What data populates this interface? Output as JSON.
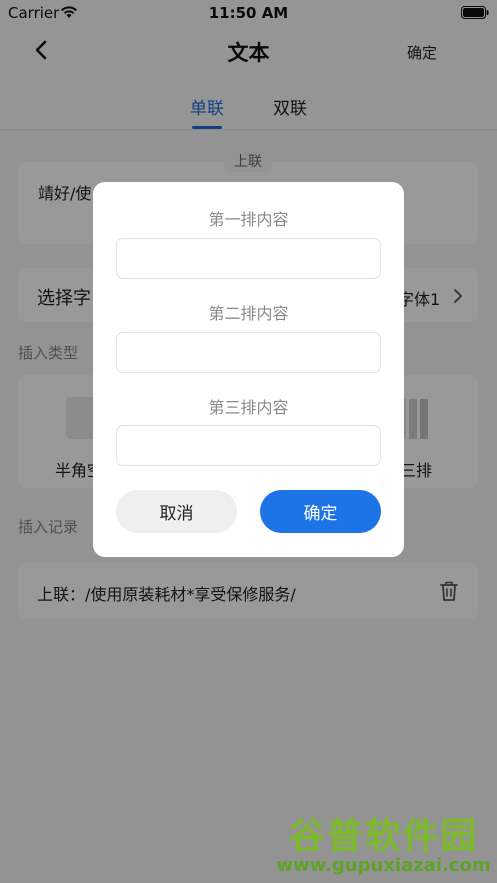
{
  "status_bar": {
    "carrier": "Carrier",
    "time": "11:50 AM"
  },
  "nav": {
    "title": "文本",
    "confirm": "确定"
  },
  "tabs": [
    {
      "label": "单联"
    },
    {
      "label": "双联"
    }
  ],
  "top_card": {
    "label": "上联",
    "text": "靖好/使"
  },
  "font_row": {
    "label": "选择字",
    "value": "字体1"
  },
  "insert_type": {
    "title": "插入类型",
    "left_label": "半角空",
    "right_label": "三排"
  },
  "insert_record": {
    "title": "插入记录",
    "items": [
      {
        "text": "上联：/使用原装耗材*享受保修服务/"
      }
    ]
  },
  "dialog": {
    "row1_label": "第一排内容",
    "row1_value": "",
    "row2_label": "第二排内容",
    "row2_value": "",
    "row3_label": "第三排内容",
    "row3_value": "",
    "cancel": "取消",
    "ok": "确定"
  },
  "watermark": {
    "title": "谷普软件园",
    "url": "www.gupuxiazai.com"
  },
  "colors": {
    "accent": "#1c74e6",
    "overlay": "rgba(0,0,0,0.4)"
  }
}
